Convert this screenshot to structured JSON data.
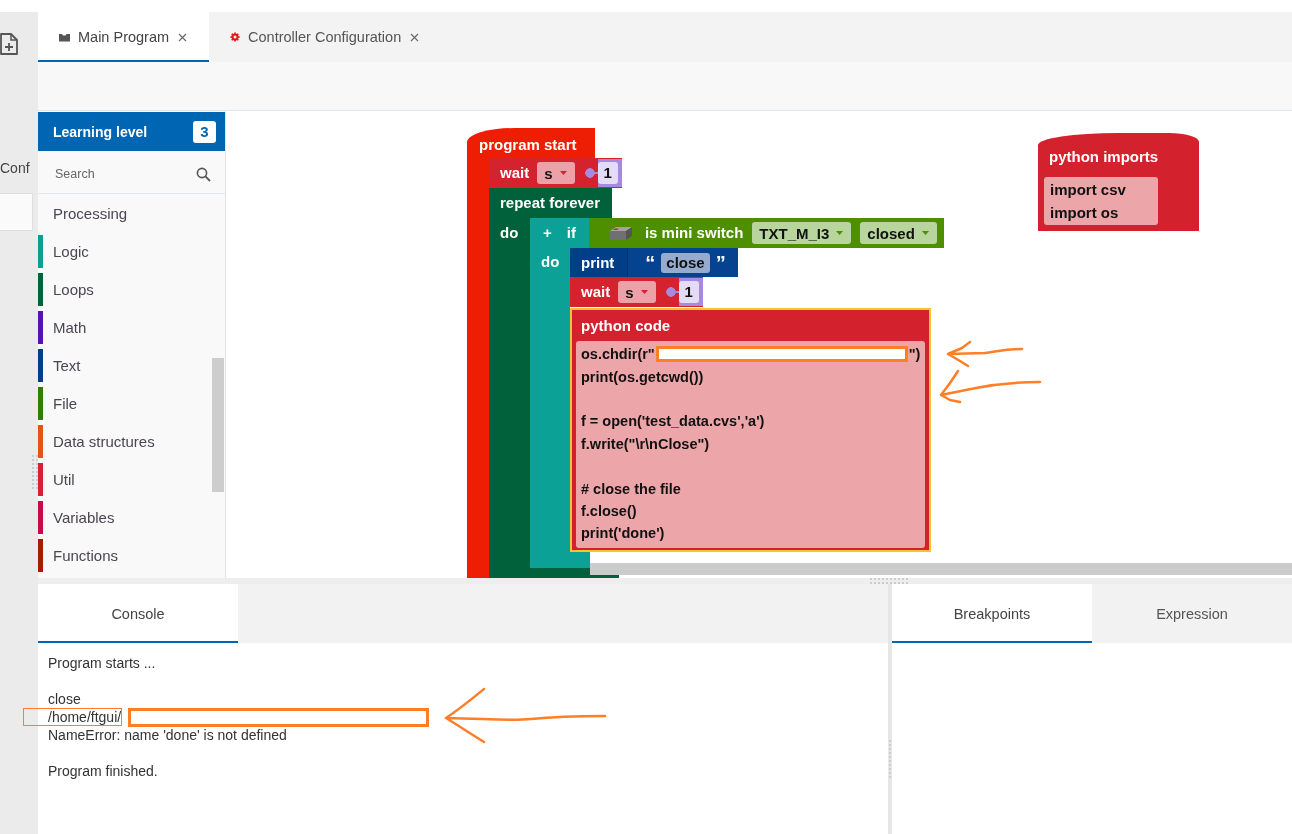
{
  "editor_tabs": [
    {
      "kind": "program",
      "label": "Main Program",
      "selected": true
    },
    {
      "kind": "config",
      "label": "Controller Configuration",
      "selected": false
    }
  ],
  "left_strip": {
    "label": "Conf"
  },
  "sidebar": {
    "title": "Learning level",
    "level_badge": "3",
    "search": {
      "placeholder": "Search"
    },
    "categories": [
      {
        "label": "Processing"
      },
      {
        "label": "Logic",
        "color": "#0aa096"
      },
      {
        "label": "Loops",
        "color": "#006339"
      },
      {
        "label": "Math",
        "color": "#5a0fb8"
      },
      {
        "label": "Text",
        "color": "#003f87"
      },
      {
        "label": "File",
        "color": "#2f7f06"
      },
      {
        "label": "Data structures",
        "color": "#e5541b"
      },
      {
        "label": "Util",
        "color": "#d6222e"
      },
      {
        "label": "Variables",
        "color": "#c60c48"
      },
      {
        "label": "Functions",
        "color": "#a51d00"
      }
    ]
  },
  "canvas": {
    "program": {
      "title": "program start",
      "blocks": [
        {
          "kind": "wait",
          "label": "wait",
          "unit": "s",
          "value": "1"
        },
        {
          "kind": "repeat",
          "label": "repeat forever",
          "do_label": "do",
          "body": [
            {
              "kind": "if",
              "plus": "+",
              "label": "if",
              "do_label": "do",
              "condition": {
                "label": "is mini switch",
                "input": "TXT_M_I3",
                "state": "closed"
              },
              "body": [
                {
                  "kind": "print",
                  "label": "print",
                  "open_quote": "“",
                  "text": "close",
                  "close_quote": "”"
                },
                {
                  "kind": "wait",
                  "label": "wait",
                  "unit": "s",
                  "value": "1"
                },
                {
                  "kind": "python_code",
                  "label": "python code",
                  "selected": true,
                  "paragraphs": [
                    {
                      "lines": [
                        {
                          "kind": "redacted",
                          "text": "os.chdir(r\"",
                          "after": "\")"
                        },
                        {
                          "kind": "text",
                          "text": "print(os.getcwd())"
                        }
                      ]
                    },
                    {
                      "lines": [
                        {
                          "kind": "text",
                          "text": "f = open('test_data.cvs','a')"
                        },
                        {
                          "kind": "text",
                          "text": "f.write(\"\\r\\nClose\")"
                        }
                      ]
                    },
                    {
                      "lines": [
                        {
                          "kind": "text",
                          "text": "# close the file"
                        },
                        {
                          "kind": "text",
                          "text": "f.close()"
                        },
                        {
                          "kind": "text",
                          "text": "print('done')"
                        }
                      ]
                    }
                  ]
                }
              ]
            }
          ]
        }
      ]
    },
    "imports": {
      "label": "python imports",
      "lines": [
        "import csv",
        "import os"
      ]
    }
  },
  "console": {
    "tabs": [
      {
        "label": "Console",
        "selected": true
      }
    ],
    "paragraphs": [
      {
        "lines": [
          {
            "kind": "text",
            "text": "Program starts ..."
          }
        ]
      },
      {
        "lines": [
          {
            "kind": "text",
            "text": "close"
          },
          {
            "kind": "redacted",
            "text": "/home/ftgui/"
          },
          {
            "kind": "text",
            "text": "NameError: name 'done' is not defined"
          }
        ]
      },
      {
        "lines": [
          {
            "kind": "text",
            "text": "Program finished."
          }
        ]
      }
    ]
  },
  "debug": {
    "tabs": [
      {
        "label": "Breakpoints",
        "selected": true
      },
      {
        "label": "Expression",
        "selected": false
      }
    ]
  }
}
